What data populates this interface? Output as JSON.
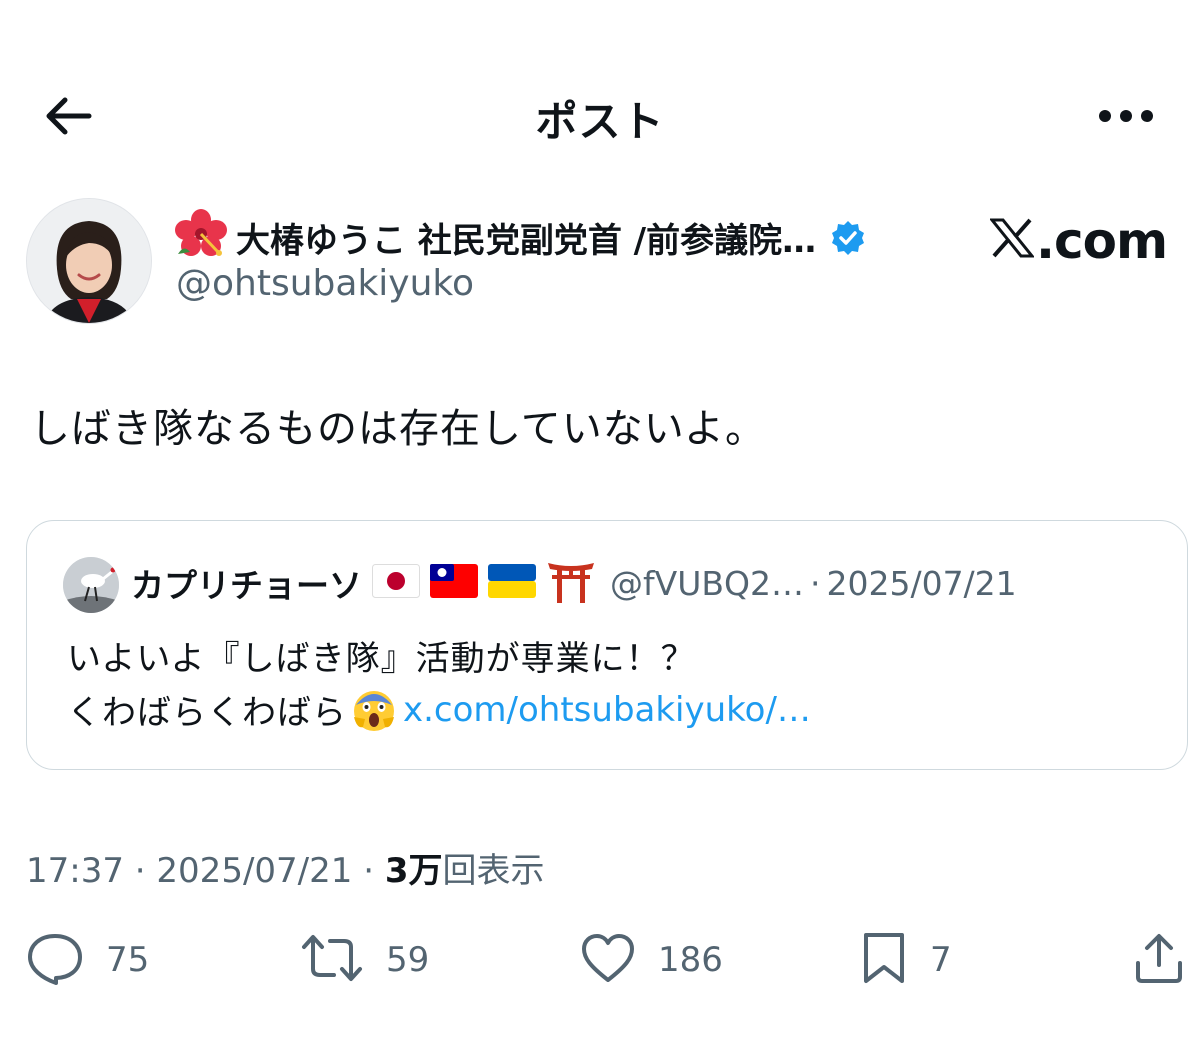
{
  "header": {
    "title": "ポスト"
  },
  "author": {
    "name": "大椿ゆうこ 社民党副党首 /前参議院…",
    "handle": "@ohtsubakiyuko",
    "verified": true,
    "emoji": "hibiscus"
  },
  "watermark": {
    "text": ".com"
  },
  "tweet": {
    "text": "しばき隊なるものは存在していないよ。"
  },
  "quote": {
    "name": "カプリチョーソ",
    "flags": [
      "japan-flag",
      "taiwan-flag",
      "ukraine-flag",
      "torii"
    ],
    "handle": "@fVUBQ2…",
    "separator": "·",
    "date": "2025/07/21",
    "line1": "いよいよ『しばき隊』活動が専業に！？",
    "line2": "くわばらくわばら",
    "emoji": "screaming-face",
    "link": "x.com/ohtsubakiyuko/…"
  },
  "meta": {
    "time": "17:37",
    "separator": "·",
    "date": "2025/07/21",
    "views_count": "3万",
    "views_label": "回表示"
  },
  "actions": {
    "replies": "75",
    "retweets": "59",
    "likes": "186",
    "bookmarks": "7"
  },
  "colors": {
    "text": "#0f1419",
    "secondary": "#536471",
    "link": "#1d9bf0",
    "verified": "#1d9bf0",
    "border": "#cfd9de"
  }
}
